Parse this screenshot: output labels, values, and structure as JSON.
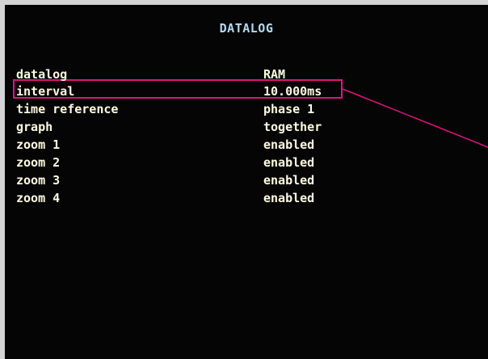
{
  "screen": {
    "title": "DATALOG",
    "accent_title_color": "#b4d9ef",
    "text_color": "#fffbe2",
    "highlight_color": "#e0137c"
  },
  "settings": [
    {
      "label": "datalog",
      "value": "RAM"
    },
    {
      "label": "interval",
      "value": "10.000ms"
    },
    {
      "label": "time reference",
      "value": "phase 1"
    },
    {
      "label": "graph",
      "value": "together"
    },
    {
      "label": "zoom 1",
      "value": "enabled"
    },
    {
      "label": "zoom 2",
      "value": "enabled"
    },
    {
      "label": "zoom 3",
      "value": "enabled"
    },
    {
      "label": "zoom 4",
      "value": "enabled"
    }
  ]
}
